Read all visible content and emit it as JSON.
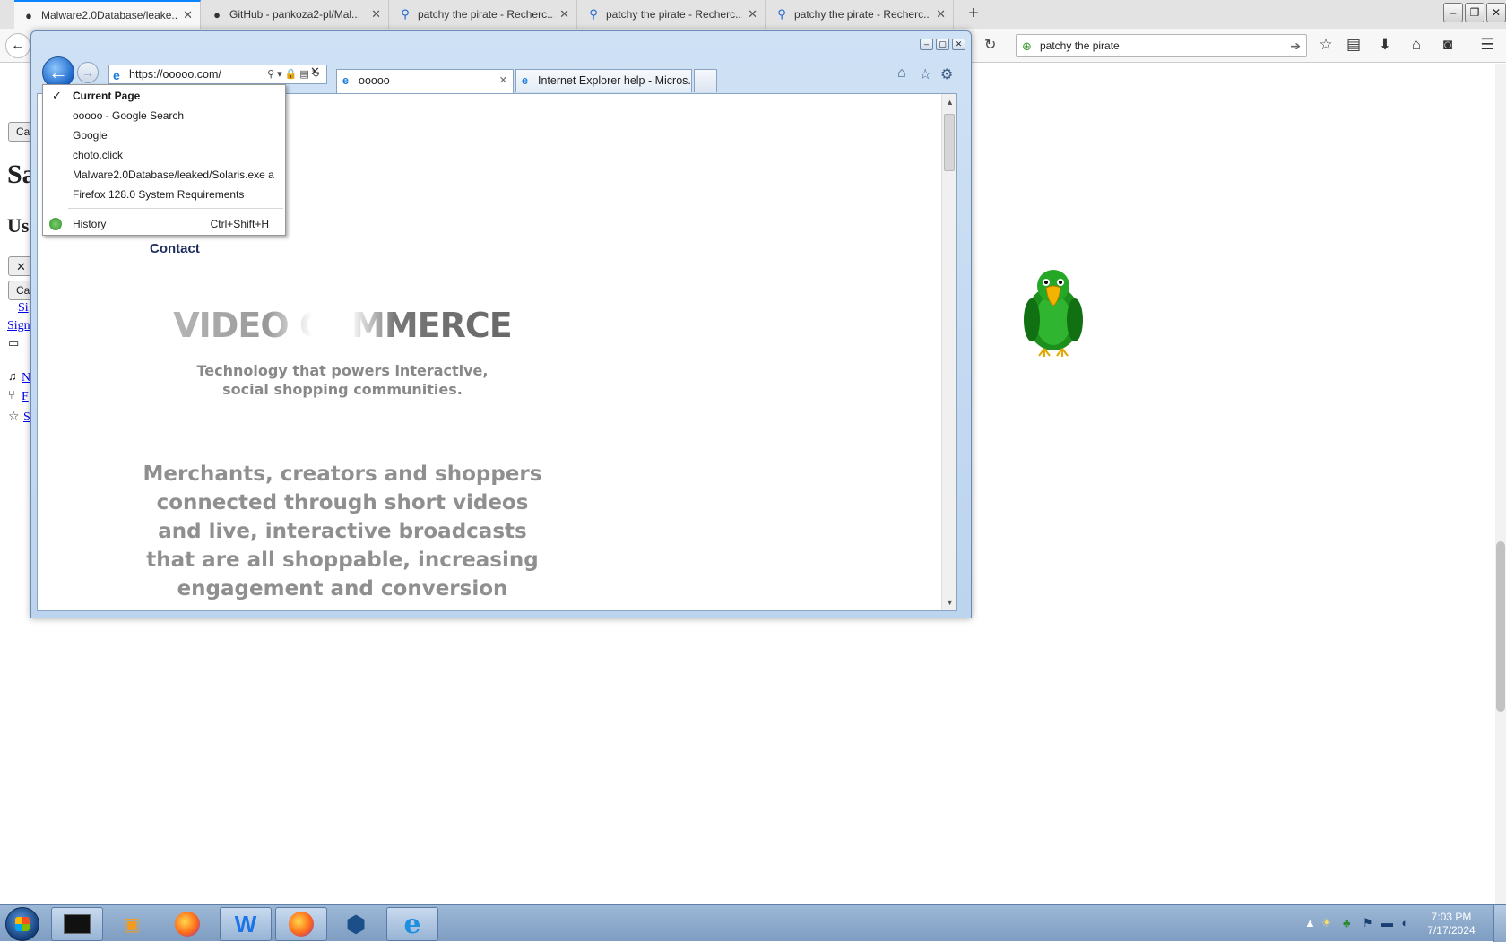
{
  "firefox": {
    "tabs": [
      {
        "label": "Malware2.0Database/leake...",
        "icon": "github-icon",
        "active": true
      },
      {
        "label": "GitHub - pankoza2-pl/Mal...",
        "icon": "github-icon",
        "active": false
      },
      {
        "label": "patchy the pirate - Recherc...",
        "icon": "search-icon",
        "active": false
      },
      {
        "label": "patchy the pirate - Recherc...",
        "icon": "search-icon",
        "active": false
      },
      {
        "label": "patchy the pirate - Recherc...",
        "icon": "search-icon",
        "active": false
      }
    ],
    "new_tab": "+",
    "search_value": "patchy the pirate",
    "bg_page": {
      "btn1": "Ca",
      "heading1": "Sa",
      "heading2": "Us",
      "close_glyph": "✕",
      "btn2": "Ca",
      "link_si": "Si",
      "link_sign": "Sign",
      "link_n": "N",
      "link_f": "F",
      "link_s": "S"
    }
  },
  "ie": {
    "address": "https://ooooo.com/",
    "tabs": [
      {
        "label": "ooooo",
        "icon": "ie-icon",
        "active": true
      },
      {
        "label": "Internet Explorer help - Micros...",
        "icon": "ie-icon",
        "active": false
      }
    ],
    "page": {
      "contact": "Contact",
      "hero_title": "VIDEO COMMERCE",
      "hero_sub": "Technology that powers interactive, social shopping communities.",
      "hero_body": "Merchants, creators and shoppers connected through short videos and live, interactive broadcasts that are all shoppable, increasing engagement and conversion"
    },
    "recent_menu": {
      "items": [
        {
          "label": "Current Page",
          "current": true
        },
        {
          "label": "ooooo - Google Search",
          "current": false
        },
        {
          "label": "Google",
          "current": false
        },
        {
          "label": "choto.click",
          "current": false
        },
        {
          "label": "Malware2.0Database/leaked/Solaris.exe a",
          "current": false
        },
        {
          "label": "Firefox 128.0 System Requirements",
          "current": false
        }
      ],
      "history_label": "History",
      "history_shortcut": "Ctrl+Shift+H"
    }
  },
  "taskbar": {
    "items": [
      "cmd-icon",
      "media-player-icon",
      "firefox-icon",
      "wordpad-icon",
      "firefox-icon",
      "virtualbox-icon",
      "internet-explorer-icon"
    ],
    "time": "7:03 PM",
    "date": "7/17/2024"
  }
}
